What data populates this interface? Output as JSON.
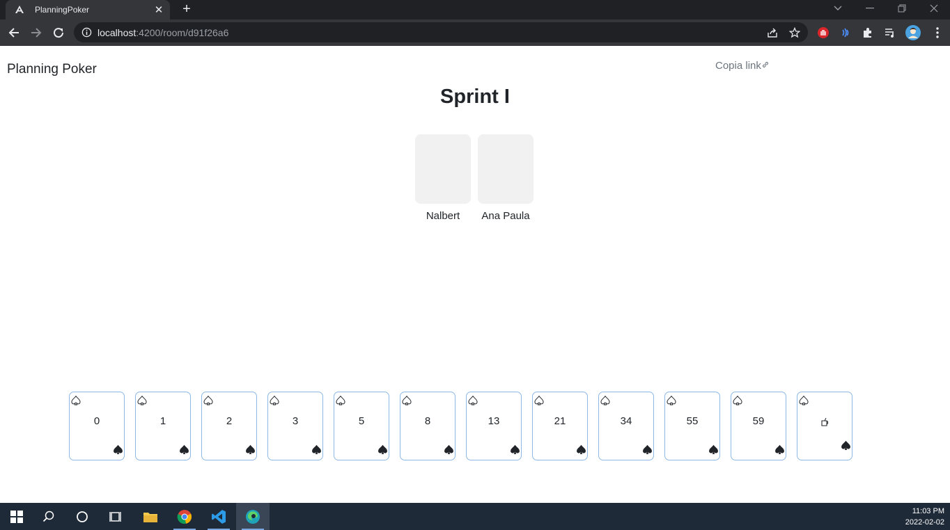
{
  "browser": {
    "tab_title": "PlanningPoker",
    "tab_close": "✕",
    "new_tab": "+",
    "url_host": "localhost",
    "url_rest": ":4200/room/d91f26a6"
  },
  "page": {
    "app_title": "Planning Poker",
    "copy_link_label": "Copia link",
    "room_title": "Sprint I"
  },
  "players": [
    {
      "name": "Nalbert"
    },
    {
      "name": "Ana Paula"
    }
  ],
  "cards": [
    {
      "label": "0"
    },
    {
      "label": "1"
    },
    {
      "label": "2"
    },
    {
      "label": "3"
    },
    {
      "label": "5"
    },
    {
      "label": "8"
    },
    {
      "label": "13"
    },
    {
      "label": "21"
    },
    {
      "label": "34"
    },
    {
      "label": "55"
    },
    {
      "label": "59"
    },
    {
      "label": "",
      "icon": "coffee-icon"
    }
  ],
  "taskbar": {
    "time": "11:03 PM",
    "date": "2022-02-02"
  },
  "colors": {
    "card_border": "#8bb8e6",
    "player_card_bg": "#f1f1f1",
    "taskbar_bg": "#1f2a38",
    "chrome_bg": "#35363a"
  }
}
